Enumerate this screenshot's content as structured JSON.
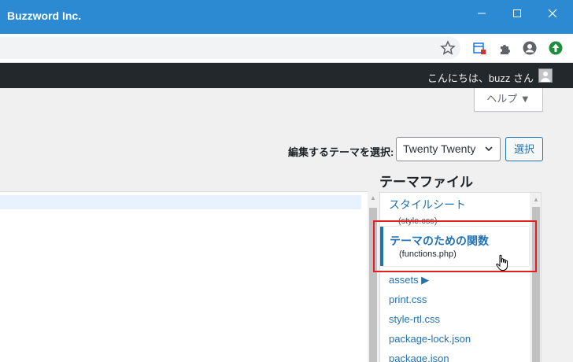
{
  "window": {
    "title": "Buzzword Inc.",
    "minimize_icon": "minimize-icon",
    "maximize_icon": "maximize-icon",
    "close_icon": "close-icon"
  },
  "toolbar": {
    "icons": [
      "bookmark-star-icon",
      "extension-badge-icon",
      "puzzle-extensions-icon",
      "profile-icon",
      "update-icon"
    ],
    "accent": "#2b8ad2"
  },
  "admin_bar": {
    "greeting": "こんにちは、buzz さん",
    "background": "#23282d"
  },
  "help": {
    "label": "ヘルプ ▼"
  },
  "theme_selector": {
    "label": "編集するテーマを選択:",
    "selected": "Twenty Twenty",
    "button": "選択"
  },
  "theme_files": {
    "title": "テーマファイル",
    "items": [
      {
        "name": "スタイルシート",
        "sub": "(style.css)"
      },
      {
        "name": "テーマのための関数",
        "sub": "(functions.php)",
        "current": true
      },
      {
        "name": "assets ▶"
      },
      {
        "name": "print.css"
      },
      {
        "name": "style-rtl.css"
      },
      {
        "name": "package-lock.json"
      },
      {
        "name": "package.json"
      }
    ]
  },
  "colors": {
    "link": "#2271b1",
    "highlight_box": "#e02020"
  }
}
